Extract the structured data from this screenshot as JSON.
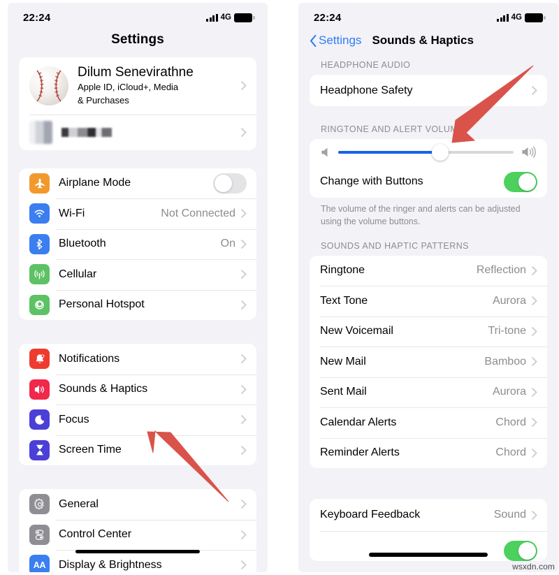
{
  "status_bar": {
    "time": "22:24",
    "network": "4G",
    "signal_icon": "signal-bars-icon",
    "battery_icon": "battery-full-icon"
  },
  "left_panel": {
    "title": "Settings",
    "account": {
      "name": "Dilum Senevirathne",
      "subtitle": "Apple ID, iCloud+, Media\n& Purchases",
      "subtitle_line1": "Apple ID, iCloud+, Media",
      "subtitle_line2": "& Purchases",
      "avatar_icon": "baseball-avatar",
      "second_row_name_redacted": "",
      "chevron_icon": "chevron-right-icon"
    },
    "groups": [
      {
        "items": [
          {
            "label": "Airplane Mode",
            "icon": "airplane-icon",
            "icon_color": "#f2992e",
            "accessory": "toggle",
            "toggle_on": false
          },
          {
            "label": "Wi-Fi",
            "icon": "wifi-icon",
            "icon_color": "#3b7ef0",
            "value": "Not Connected",
            "accessory": "chevron"
          },
          {
            "label": "Bluetooth",
            "icon": "bluetooth-icon",
            "icon_color": "#3b7ef0",
            "value": "On",
            "accessory": "chevron"
          },
          {
            "label": "Cellular",
            "icon": "cellular-icon",
            "icon_color": "#5dc264",
            "value": "",
            "accessory": "chevron"
          },
          {
            "label": "Personal Hotspot",
            "icon": "hotspot-icon",
            "icon_color": "#5dc264",
            "value": "",
            "accessory": "chevron"
          }
        ]
      },
      {
        "items": [
          {
            "label": "Notifications",
            "icon": "notifications-bell-icon",
            "icon_color": "#ee3b30",
            "value": "",
            "accessory": "chevron"
          },
          {
            "label": "Sounds & Haptics",
            "icon": "sounds-speaker-icon",
            "icon_color": "#f0284a",
            "value": "",
            "accessory": "chevron"
          },
          {
            "label": "Focus",
            "icon": "focus-moon-icon",
            "icon_color": "#4a3fd6",
            "value": "",
            "accessory": "chevron"
          },
          {
            "label": "Screen Time",
            "icon": "screen-time-hourglass-icon",
            "icon_color": "#4a3fd6",
            "value": "",
            "accessory": "chevron"
          }
        ]
      },
      {
        "items": [
          {
            "label": "General",
            "icon": "gear-icon",
            "icon_color": "#8e8e93",
            "value": "",
            "accessory": "chevron"
          },
          {
            "label": "Control Center",
            "icon": "control-center-toggles-icon",
            "icon_color": "#8e8e93",
            "value": "",
            "accessory": "chevron"
          },
          {
            "label": "Display & Brightness",
            "icon": "display-brightness-aa-icon",
            "icon_color": "#3b7ef0",
            "value": "",
            "accessory": "chevron"
          }
        ]
      }
    ]
  },
  "right_panel": {
    "nav": {
      "back_label": "Settings",
      "back_icon": "chevron-left-icon",
      "title": "Sounds & Haptics"
    },
    "sections": [
      {
        "header": "HEADPHONE AUDIO",
        "items": [
          {
            "label": "Headphone Safety",
            "value": "",
            "accessory": "chevron"
          }
        ]
      },
      {
        "header": "RINGTONE AND ALERT VOLUME",
        "slider": {
          "name": "ringtone-volume-slider",
          "value_percent": 58,
          "min_icon": "speaker-low-icon",
          "max_icon": "speaker-high-icon",
          "fill_color": "#1862e8"
        },
        "items": [
          {
            "label": "Change with Buttons",
            "accessory": "toggle",
            "toggle_on": true
          }
        ],
        "footer": "The volume of the ringer and alerts can be adjusted using the volume buttons."
      },
      {
        "header": "SOUNDS AND HAPTIC PATTERNS",
        "items": [
          {
            "label": "Ringtone",
            "value": "Reflection",
            "accessory": "chevron"
          },
          {
            "label": "Text Tone",
            "value": "Aurora",
            "accessory": "chevron"
          },
          {
            "label": "New Voicemail",
            "value": "Tri-tone",
            "accessory": "chevron"
          },
          {
            "label": "New Mail",
            "value": "Bamboo",
            "accessory": "chevron"
          },
          {
            "label": "Sent Mail",
            "value": "Aurora",
            "accessory": "chevron"
          },
          {
            "label": "Calendar Alerts",
            "value": "Chord",
            "accessory": "chevron"
          },
          {
            "label": "Reminder Alerts",
            "value": "Chord",
            "accessory": "chevron"
          }
        ]
      },
      {
        "header": "",
        "items": [
          {
            "label": "Keyboard Feedback",
            "value": "Sound",
            "accessory": "chevron"
          }
        ]
      }
    ]
  },
  "annotations": {
    "arrow_color": "#d9534a",
    "arrows": [
      {
        "name": "arrow-pointing-to-ringtone-volume-section"
      },
      {
        "name": "arrow-pointing-to-sounds-and-haptics-row"
      }
    ]
  },
  "watermark": {
    "text": "wsxdn.com"
  }
}
